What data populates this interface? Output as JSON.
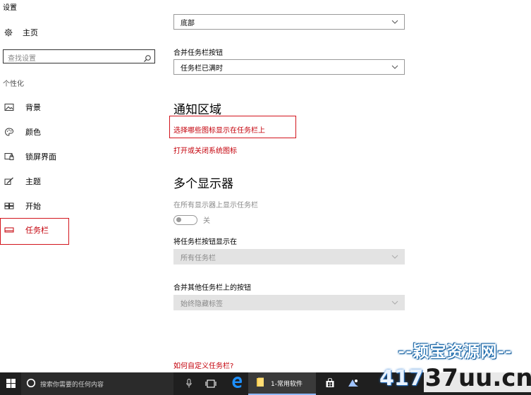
{
  "app": {
    "title": "设置"
  },
  "sidebar": {
    "home_label": "主页",
    "search_placeholder": "查找设置",
    "section_label": "个性化",
    "items": [
      {
        "label": "背景",
        "icon": "picture-icon"
      },
      {
        "label": "颜色",
        "icon": "palette-icon"
      },
      {
        "label": "锁屏界面",
        "icon": "lock-screen-icon"
      },
      {
        "label": "主题",
        "icon": "theme-brush-icon"
      },
      {
        "label": "开始",
        "icon": "start-grid-icon"
      },
      {
        "label": "任务栏",
        "icon": "taskbar-icon",
        "active": true
      }
    ]
  },
  "main": {
    "position_dropdown": {
      "value": "底部"
    },
    "combine_label": "合并任务栏按钮",
    "combine_dropdown": {
      "value": "任务栏已满时"
    },
    "notification_heading": "通知区域",
    "notification_link_1": "选择哪些图标显示在任务栏上",
    "notification_link_2": "打开或关闭系统图标",
    "multi_display_heading": "多个显示器",
    "show_all_label": "在所有显示器上显示任务栏",
    "show_all_toggle": {
      "state": "关",
      "on": false
    },
    "show_buttons_label": "将任务栏按钮显示在",
    "show_buttons_dropdown": {
      "value": "所有任务栏"
    },
    "combine_other_label": "合并其他任务栏上的按钮",
    "combine_other_dropdown": {
      "value": "始终隐藏标签"
    },
    "help_link": "如何自定义任务栏?"
  },
  "taskbar": {
    "search_placeholder": "搜索你需要的任何内容",
    "folder_label": "1-常用软件"
  },
  "watermark": {
    "line1": "--颖宝资源网--",
    "line2_part1": "417",
    "line2_part2": "37uu.cn"
  },
  "colors": {
    "accent_red": "#c4000a",
    "frame_red": "#d2141c",
    "taskbar_bg": "#1f1f1f",
    "edge_blue": "#1e90ff"
  }
}
